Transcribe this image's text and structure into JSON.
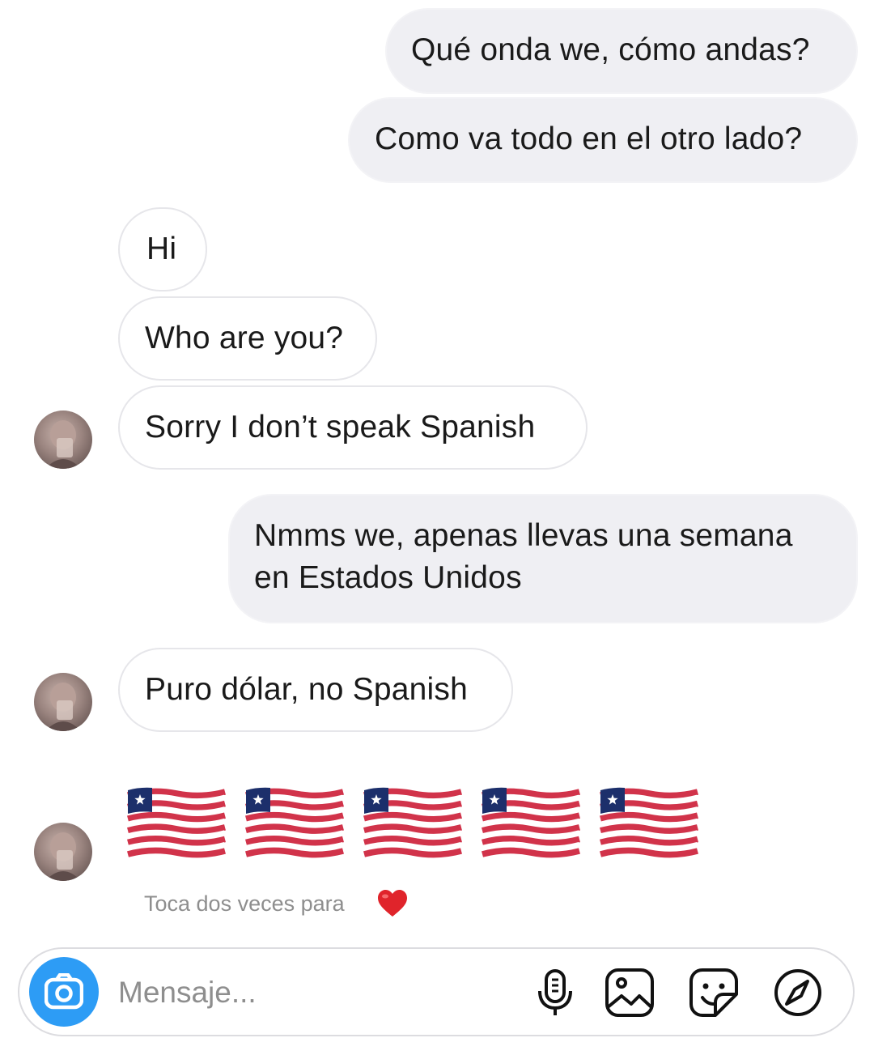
{
  "messages": [
    {
      "from": "me",
      "text": "Qué onda we, cómo andas?"
    },
    {
      "from": "me",
      "text": "Como va todo en el otro lado?"
    },
    {
      "from": "them",
      "text": "Hi"
    },
    {
      "from": "them",
      "text": "Who are you?"
    },
    {
      "from": "them",
      "text": "Sorry I don’t speak Spanish"
    },
    {
      "from": "me",
      "lines": [
        "Nmms we, apenas llevas una semana",
        "en Estados Unidos"
      ]
    },
    {
      "from": "them",
      "text": "Puro dólar, no Spanish"
    },
    {
      "from": "them",
      "emoji": "liberia-flag-emoji",
      "emoji_count": 5
    }
  ],
  "reaction_hint": {
    "text": "Toca dos veces para",
    "icon": "red-heart-icon"
  },
  "composer": {
    "placeholder": "Mensaje...",
    "camera_icon": "camera-icon",
    "tools": [
      "microphone-icon",
      "gallery-icon",
      "sticker-icon",
      "compass-icon"
    ]
  },
  "colors": {
    "outgoing_bubble": "#efeff3",
    "incoming_border": "#e6e6ea",
    "camera_button": "#2d9cf5",
    "flag_red": "#d1334a",
    "flag_blue": "#1c2f6b",
    "heart": "#e0242b"
  }
}
